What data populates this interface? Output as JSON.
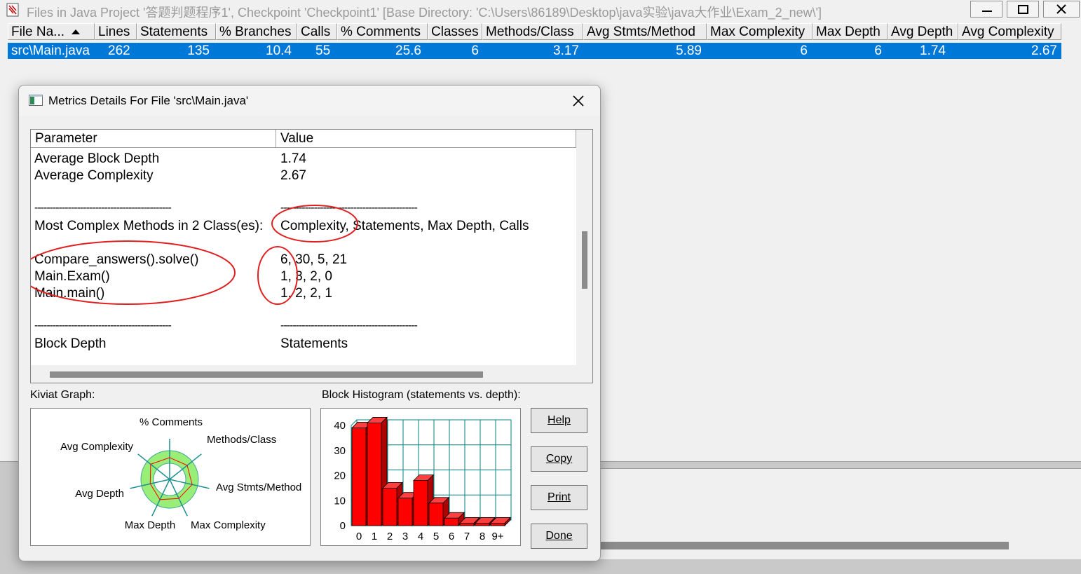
{
  "main_window": {
    "title": "Files in Java Project '答题判题程序1', Checkpoint 'Checkpoint1'  [Base Directory: 'C:\\Users\\86189\\Desktop\\java实验\\java大作业\\Exam_2_new\\']",
    "columns": [
      "File Na...",
      "Lines",
      "Statements",
      "% Branches",
      "Calls",
      "% Comments",
      "Classes",
      "Methods/Class",
      "Avg Stmts/Method",
      "Max Complexity",
      "Max Depth",
      "Avg Depth",
      "Avg Complexity"
    ],
    "rows": [
      [
        "src\\Main.java",
        "262",
        "135",
        "10.4",
        "55",
        "25.6",
        "6",
        "3.17",
        "5.89",
        "6",
        "6",
        "1.74",
        "2.67"
      ]
    ]
  },
  "dialog": {
    "title": "Metrics Details For File 'src\\Main.java'",
    "headers": {
      "parameter": "Parameter",
      "value": "Value"
    },
    "rows": [
      {
        "param": "Average Block Depth",
        "value": "1.74"
      },
      {
        "param": "Average Complexity",
        "value": "2.67"
      },
      {
        "param": "",
        "value": ""
      },
      {
        "param": "---------------------------------------------",
        "value": "---------------------------------------------"
      },
      {
        "param": "Most Complex Methods in 2 Class(es):",
        "value": "Complexity, Statements, Max Depth, Calls"
      },
      {
        "param": "",
        "value": ""
      },
      {
        "param": "Compare_answers().solve()",
        "value": "6, 30, 5, 21"
      },
      {
        "param": "Main.Exam()",
        "value": "1, 3, 2, 0"
      },
      {
        "param": "Main.main()",
        "value": "1, 2, 2, 1"
      },
      {
        "param": "",
        "value": ""
      },
      {
        "param": "---------------------------------------------",
        "value": "---------------------------------------------"
      },
      {
        "param": "Block Depth",
        "value": "Statements"
      }
    ],
    "kiviat_label": "Kiviat Graph:",
    "histogram_label": "Block Histogram (statements vs. depth):",
    "kiviat_axes": [
      "% Comments",
      "Methods/Class",
      "Avg Stmts/Method",
      "Max Complexity",
      "Max Depth",
      "Avg Depth",
      "Avg Complexity"
    ],
    "buttons": {
      "help": "Help",
      "copy": "Copy",
      "print": "Print",
      "done": "Done"
    }
  },
  "chart_data": {
    "type": "bar",
    "title": "Block Histogram (statements vs. depth):",
    "categories": [
      "0",
      "1",
      "2",
      "3",
      "4",
      "5",
      "6",
      "7",
      "8",
      "9+"
    ],
    "values": [
      39,
      41,
      15,
      11,
      18,
      9,
      3,
      1,
      1,
      1
    ],
    "ylim": [
      0,
      40
    ],
    "yticks": [
      0,
      10,
      20,
      30,
      40
    ],
    "bar_color": "#ff0000",
    "grid_color": "#008080"
  },
  "colors": {
    "selection": "#0078d7",
    "annotation": "#e02020"
  }
}
